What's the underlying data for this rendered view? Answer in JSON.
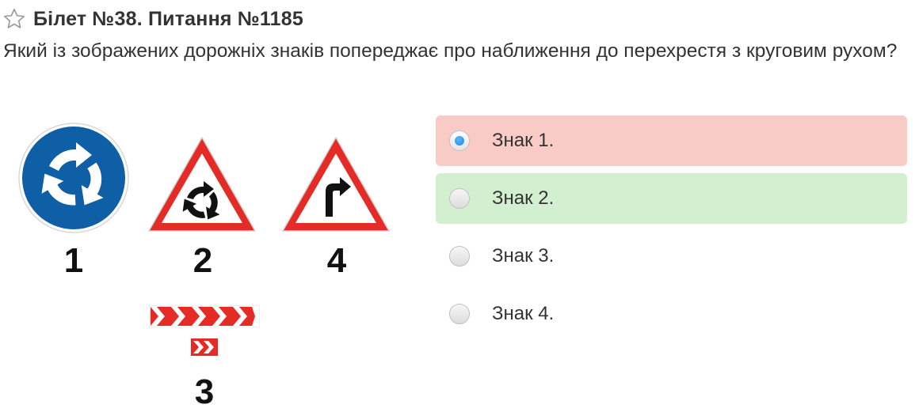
{
  "header": {
    "title": "Білет №38. Питання №1185",
    "star_icon": "star-outline-icon"
  },
  "question": {
    "text": "Який із зображених дорожніх знаків попереджає про наближення до перехрестя з круговим рухом?"
  },
  "signs": {
    "numbers": [
      "1",
      "2",
      "4",
      "3"
    ]
  },
  "answers": [
    {
      "label": "Знак 1.",
      "state": "selected-wrong"
    },
    {
      "label": "Знак 2.",
      "state": "correct"
    },
    {
      "label": "Знак 3.",
      "state": "none"
    },
    {
      "label": "Знак 4.",
      "state": "none"
    }
  ],
  "colors": {
    "wrong_bg": "#f9cbc6",
    "correct_bg": "#d2f0d0",
    "sign_red": "#e42b26",
    "sign_blue": "#0f5fa6",
    "radio_selected": "#1f86e8"
  }
}
